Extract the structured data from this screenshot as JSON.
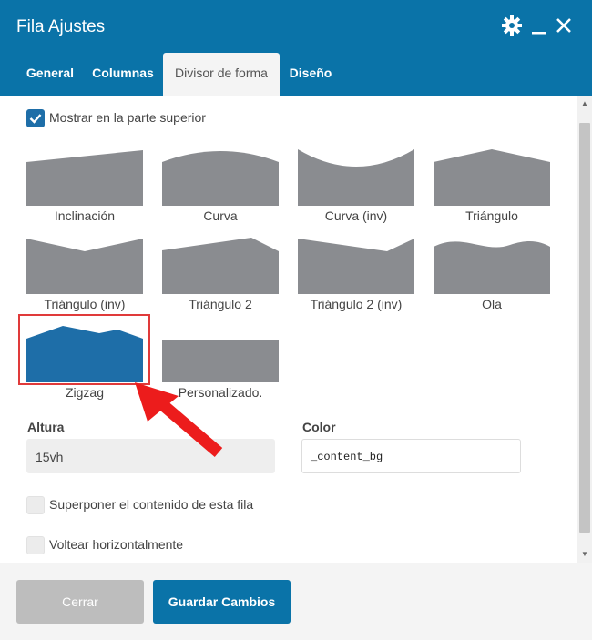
{
  "window": {
    "title": "Fila Ajustes",
    "titlebar_color": "#0a73a8",
    "icons": [
      "gear-icon",
      "minimize-icon",
      "close-icon"
    ]
  },
  "tabs": [
    {
      "label": "General",
      "active": false
    },
    {
      "label": "Columnas",
      "active": false
    },
    {
      "label": "Divisor de forma",
      "active": true
    },
    {
      "label": "Diseño",
      "active": false
    }
  ],
  "show_top": {
    "label": "Mostrar en la parte superior",
    "checked": true
  },
  "shapes": [
    {
      "label": "Inclinación"
    },
    {
      "label": "Curva"
    },
    {
      "label": "Curva (inv)"
    },
    {
      "label": "Triángulo"
    },
    {
      "label": "Triángulo (inv)"
    },
    {
      "label": "Triángulo 2"
    },
    {
      "label": "Triángulo 2 (inv)"
    },
    {
      "label": "Ola"
    },
    {
      "label": "Zigzag",
      "selected": true
    },
    {
      "label": "Personalizado."
    }
  ],
  "shape_color": "#8a8c90",
  "selected_color": "#1e6ea8",
  "highlight_color": "#e03a3a",
  "height_field": {
    "label": "Altura",
    "value": "15vh"
  },
  "color_field": {
    "label": "Color",
    "value": "_content_bg"
  },
  "overlap": {
    "label": "Superponer el contenido de esta fila",
    "checked": false
  },
  "flip": {
    "label": "Voltear horizontalmente",
    "checked": false
  },
  "buttons": {
    "close": "Cerrar",
    "save": "Guardar Cambios"
  }
}
